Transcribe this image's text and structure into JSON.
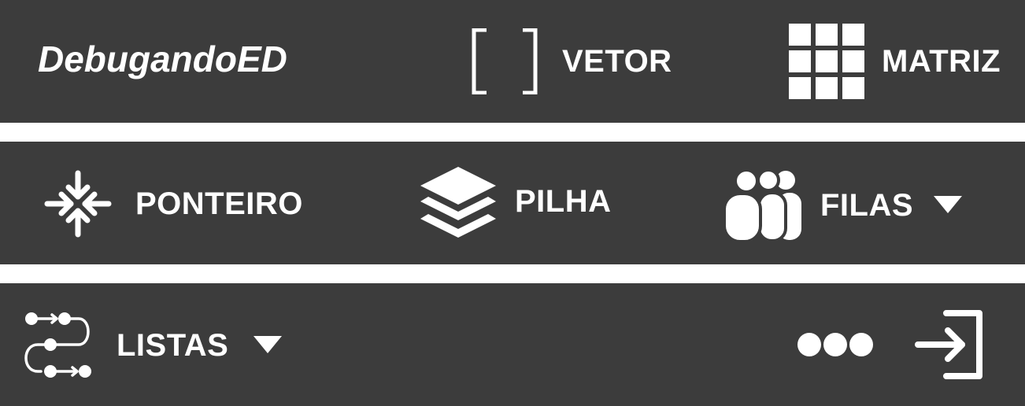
{
  "brand": {
    "title": "DebugandoED"
  },
  "nav": {
    "row1": [
      {
        "label": "VETOR",
        "icon": "brackets-icon"
      },
      {
        "label": "MATRIZ",
        "icon": "grid-icon"
      }
    ],
    "row2": [
      {
        "label": "PONTEIRO",
        "icon": "pointer-arrows-icon"
      },
      {
        "label": "PILHA",
        "icon": "stack-layers-icon"
      },
      {
        "label": "FILAS",
        "icon": "queue-people-icon",
        "dropdown": true
      }
    ],
    "row3": [
      {
        "label": "LISTAS",
        "icon": "linked-list-icon",
        "dropdown": true
      }
    ]
  },
  "actions": {
    "more": "more-icon",
    "logout": "logout-icon"
  },
  "colors": {
    "bar": "#3c3c3c",
    "background": "#ffffff",
    "foreground": "#ffffff"
  }
}
